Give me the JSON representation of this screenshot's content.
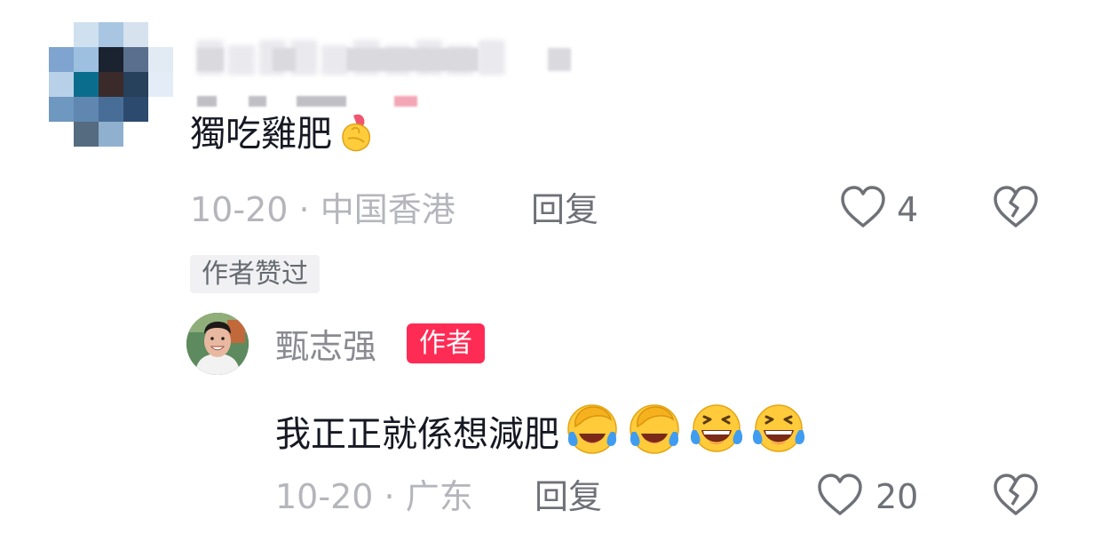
{
  "comment1": {
    "avatar_icon": "pixelated-avatar",
    "text": "獨吃雞肥",
    "emoji_icon": "finger-heart-emoji",
    "date": "10-20",
    "separator": "·",
    "location": "中国香港",
    "reply_label": "回复",
    "like_count": "4",
    "liked_by_author_label": "作者赞过"
  },
  "reply1": {
    "avatar_icon": "user-avatar",
    "username": "甄志强",
    "author_badge": "作者",
    "text": "我正正就係想減肥",
    "emoji_icons": [
      "face-palm-crying-emoji",
      "face-palm-crying-emoji",
      "tears-of-joy-emoji",
      "tears-of-joy-emoji"
    ],
    "date": "10-20",
    "separator": "·",
    "location": "广东",
    "reply_label": "回复",
    "like_count": "20"
  },
  "colors": {
    "accent": "#fe2c55",
    "meta_text": "#b4b6bc",
    "primary_text": "#161823"
  }
}
